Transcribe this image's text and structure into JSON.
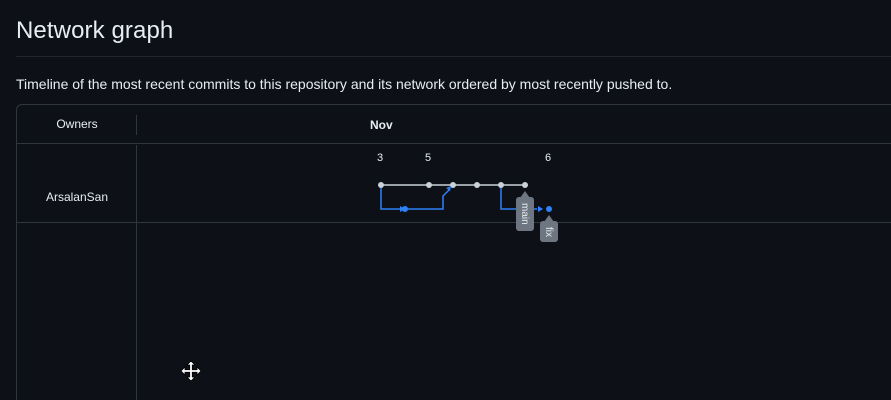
{
  "page": {
    "title": "Network graph",
    "description": "Timeline of the most recent commits to this repository and its network ordered by most recently pushed to."
  },
  "graph": {
    "owners_header": "Owners",
    "month": "Nov",
    "days": [
      {
        "label": "3"
      },
      {
        "label": "5"
      },
      {
        "label": "6"
      }
    ],
    "owners": [
      {
        "name": "ArsalanSan"
      }
    ],
    "branches": [
      {
        "label": "main"
      },
      {
        "label": "fix"
      }
    ],
    "colors": {
      "main_line": "#c9d1d9",
      "branch_line": "#2f81f7",
      "tag_bg": "#6e7681"
    }
  },
  "cursor": {
    "icon": "move-icon"
  }
}
